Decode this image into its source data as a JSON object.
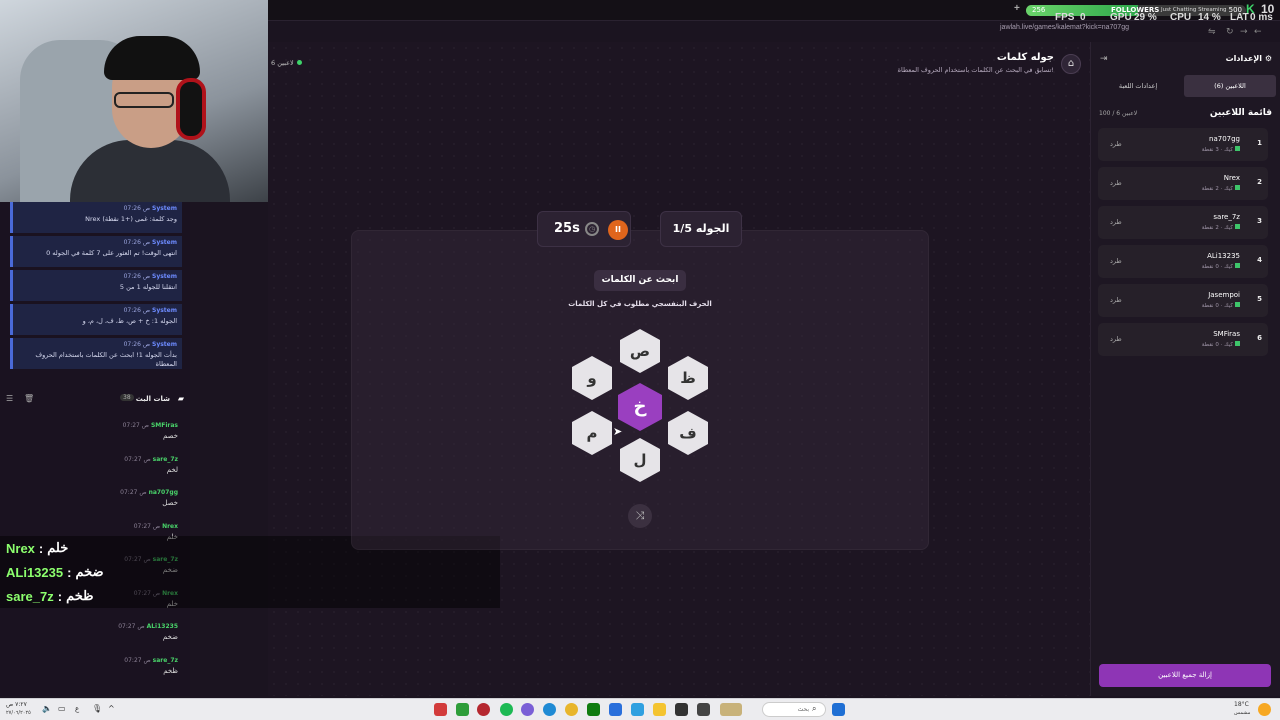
{
  "browser": {
    "url": "jawlah.live/games/kalemat?kick=na707gg",
    "stats": {
      "fps_label": "FPS",
      "fps": "0",
      "gpu_label": "GPU",
      "gpu": "29 %",
      "cpu_label": "CPU",
      "cpu": "14 %",
      "lat_label": "LAT",
      "lat": "0 ms"
    },
    "followers": {
      "label": "FOLLOWERS",
      "current": "256",
      "goal": "500",
      "extra": "Just Chatting Streaming",
      "count": "10"
    },
    "plus": "+"
  },
  "game": {
    "title": "جوله كلمات",
    "subtitle": "تسابق في البحث عن الكلمات باستخدام الحروف المعطاة!",
    "online": "6 لاعبين",
    "timer": "25s",
    "round": "الجوله 1/5",
    "find_label": "ابحث عن الكلمات",
    "hint": "الحرف البنفسجي مطلوب في كل الكلمات",
    "center_letter": "خ",
    "letters": {
      "top": "ص",
      "top_right": "ظ",
      "bottom_right": "ف",
      "bottom": "ل",
      "bottom_left": "م",
      "top_left": "و"
    }
  },
  "sidebar": {
    "title": "الإعدادات",
    "tabs": [
      "اللاعبين (6)",
      "إعدادات اللعبة"
    ],
    "players_heading": "قائمة اللاعبين",
    "players_count": "100 / 6 لاعبين",
    "kick_label": "طرد",
    "players": [
      {
        "rank": "1",
        "name": "na707gg",
        "sub": "كيك · 3 نقطة"
      },
      {
        "rank": "2",
        "name": "Nrex",
        "sub": "كيك · 2 نقطة"
      },
      {
        "rank": "3",
        "name": "sare_7z",
        "sub": "كيك · 2 نقطة"
      },
      {
        "rank": "4",
        "name": "ALi13235",
        "sub": "كيك · 0 نقطة"
      },
      {
        "rank": "5",
        "name": "Jasempoi",
        "sub": "كيك · 0 نقطة"
      },
      {
        "rank": "6",
        "name": "SMFiras",
        "sub": "كيك · 0 نقطة"
      }
    ],
    "remove_all": "إزالة جميع اللاعبين"
  },
  "chat": {
    "system_messages": [
      {
        "sender": "System",
        "time": "07:26 ص",
        "text": "Nrex وجد كلمة: غمى (+1 نقطة)"
      },
      {
        "sender": "System",
        "time": "07:26 ص",
        "text": "انتهى الوقت! تم العثور على 7 كلمة في الجوله 0"
      },
      {
        "sender": "System",
        "time": "07:26 ص",
        "text": "انتقلنا للجوله 1 من 5"
      },
      {
        "sender": "System",
        "time": "07:26 ص",
        "text": "الجوله 1: خ + ص، ظ، ف، ل، م، و"
      },
      {
        "sender": "System",
        "time": "07:26 ص",
        "text": "بدأت الجوله 1! ابحث عن الكلمات باستخدام الحروف المعطاة"
      }
    ],
    "header": "شات البث",
    "header_count": "38",
    "messages": [
      {
        "user": "SMFiras",
        "time": "07:27 ص",
        "text": "خصم"
      },
      {
        "user": "sare_7z",
        "time": "07:27 ص",
        "text": "لخم"
      },
      {
        "user": "na707gg",
        "time": "07:27 ص",
        "text": "خصل"
      },
      {
        "user": "Nrex",
        "time": "07:27 ص",
        "text": "خلم"
      },
      {
        "user": "sare_7z",
        "time": "07:27 ص",
        "text": "ضخم"
      },
      {
        "user": "Nrex",
        "time": "07:27 ص",
        "text": "خلم"
      },
      {
        "user": "ALi13235",
        "time": "07:27 ص",
        "text": "ضخم"
      },
      {
        "user": "sare_7z",
        "time": "07:27 ص",
        "text": "ظخم"
      }
    ]
  },
  "overlay": [
    {
      "user": "Nrex",
      "text": "خلم"
    },
    {
      "user": "ALi13235",
      "text": "ضخم"
    },
    {
      "user": "sare_7z",
      "text": "ظخم"
    }
  ],
  "taskbar": {
    "search_placeholder": "بحث",
    "weather": "18°C",
    "weather_sub": "مشمس",
    "time": "٧:٢٧ ص",
    "date": "٢٧/٠٦/٢٠٢٥",
    "lang": "ع"
  }
}
